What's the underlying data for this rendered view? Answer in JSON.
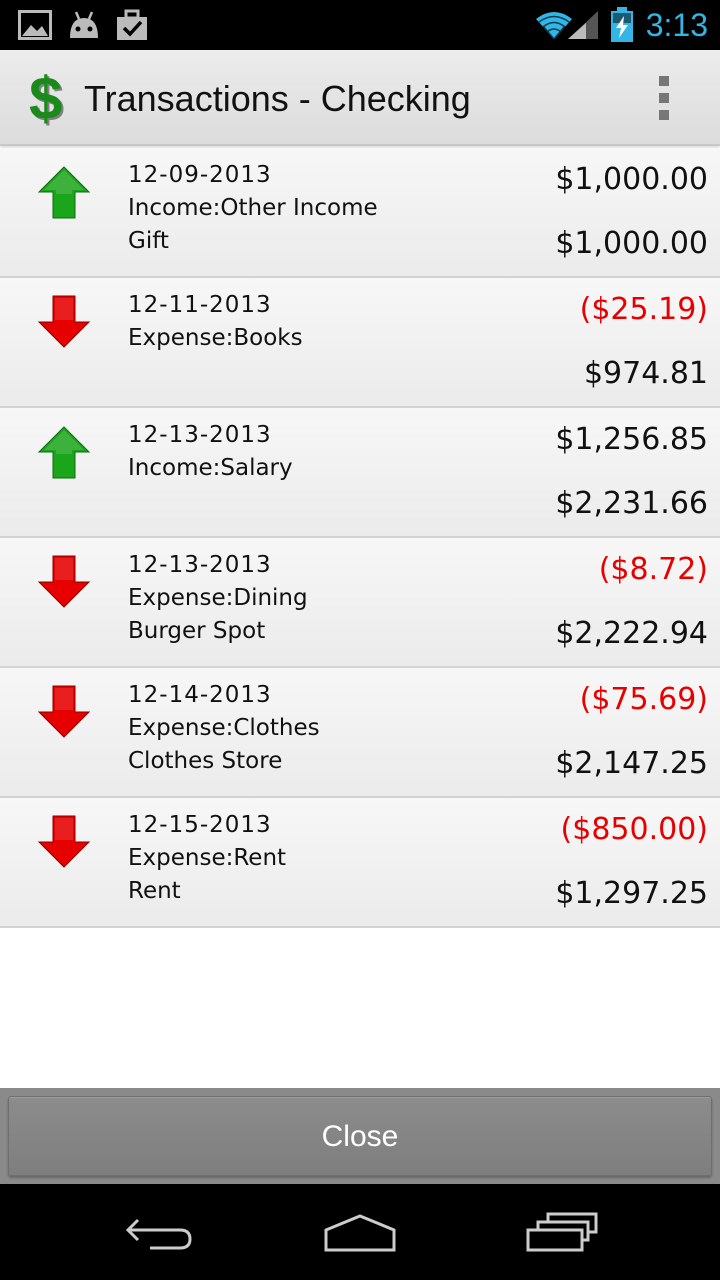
{
  "status_bar": {
    "time": "3:13",
    "left_icons": [
      "gallery-icon",
      "android-icon",
      "briefcase-check-icon"
    ],
    "right_icons": [
      "wifi-icon",
      "signal-icon",
      "battery-charging-icon"
    ],
    "accent_color": "#33b5e5"
  },
  "action_bar": {
    "title": "Transactions - Checking",
    "logo_icon": "dollar-sign-icon",
    "overflow_icon": "overflow-menu-icon"
  },
  "colors": {
    "income": "#1aa51a",
    "expense": "#e60000",
    "negative_text": "#e60000"
  },
  "transactions": [
    {
      "type": "income",
      "icon": "arrow-up-icon",
      "date": "12-09-2013",
      "category": "Income:Other Income",
      "payee": "Gift",
      "amount": "$1,000.00",
      "balance": "$1,000.00",
      "negative": false
    },
    {
      "type": "expense",
      "icon": "arrow-down-icon",
      "date": "12-11-2013",
      "category": "Expense:Books",
      "payee": "",
      "amount": "($25.19)",
      "balance": "$974.81",
      "negative": true
    },
    {
      "type": "income",
      "icon": "arrow-up-icon",
      "date": "12-13-2013",
      "category": "Income:Salary",
      "payee": "",
      "amount": "$1,256.85",
      "balance": "$2,231.66",
      "negative": false
    },
    {
      "type": "expense",
      "icon": "arrow-down-icon",
      "date": "12-13-2013",
      "category": "Expense:Dining",
      "payee": "Burger Spot",
      "amount": "($8.72)",
      "balance": "$2,222.94",
      "negative": true
    },
    {
      "type": "expense",
      "icon": "arrow-down-icon",
      "date": "12-14-2013",
      "category": "Expense:Clothes",
      "payee": "Clothes Store",
      "amount": "($75.69)",
      "balance": "$2,147.25",
      "negative": true
    },
    {
      "type": "expense",
      "icon": "arrow-down-icon",
      "date": "12-15-2013",
      "category": "Expense:Rent",
      "payee": "Rent",
      "amount": "($850.00)",
      "balance": "$1,297.25",
      "negative": true
    }
  ],
  "close_button": {
    "label": "Close"
  },
  "nav_bar": {
    "buttons": [
      "back-icon",
      "home-icon",
      "recent-apps-icon"
    ]
  }
}
